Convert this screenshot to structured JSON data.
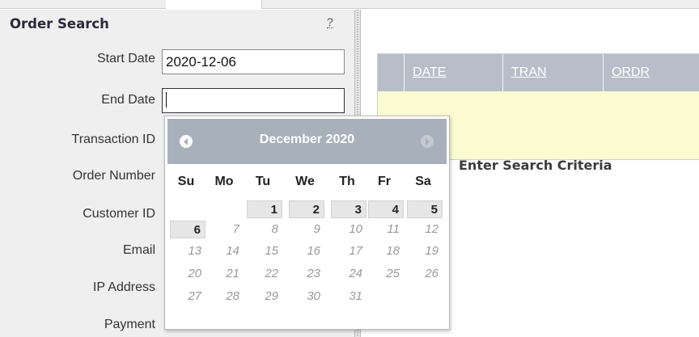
{
  "order_search": {
    "title": "Order Search",
    "help": "?",
    "fields": [
      {
        "label": "Start Date",
        "value": "2020-12-06",
        "placeholder": ""
      },
      {
        "label": "End Date",
        "value": "",
        "placeholder": ""
      },
      {
        "label": "Transaction ID",
        "value": "",
        "placeholder": ""
      },
      {
        "label": "Order Number",
        "value": "",
        "placeholder": ""
      },
      {
        "label": "Customer ID",
        "value": "",
        "placeholder": ""
      },
      {
        "label": "Email",
        "value": "",
        "placeholder": ""
      },
      {
        "label": "IP Address",
        "value": "",
        "placeholder": ""
      },
      {
        "label": "Payment",
        "value": "",
        "placeholder": ""
      }
    ]
  },
  "results": {
    "columns": [
      "DATE",
      "TRAN",
      "ORDR"
    ],
    "empty_message": "Enter Search Criteria"
  },
  "calendar": {
    "month_title": "December 2020",
    "prev_icon": "chevron-left-icon",
    "next_icon": "chevron-right-icon",
    "weekdays": [
      "Su",
      "Mo",
      "Tu",
      "We",
      "Th",
      "Fr",
      "Sa"
    ],
    "weeks": [
      [
        "",
        "",
        "1",
        "2",
        "3",
        "4",
        "5"
      ],
      [
        "6",
        "7",
        "8",
        "9",
        "10",
        "11",
        "12"
      ],
      [
        "13",
        "14",
        "15",
        "16",
        "17",
        "18",
        "19"
      ],
      [
        "20",
        "21",
        "22",
        "23",
        "24",
        "25",
        "26"
      ],
      [
        "27",
        "28",
        "29",
        "30",
        "31",
        "",
        ""
      ]
    ]
  },
  "colors": {
    "header_bg": "#b7bec9",
    "calendar_header": "#a8b0bb",
    "results_body": "#fbfbd2",
    "panel_bg": "#efefef"
  }
}
